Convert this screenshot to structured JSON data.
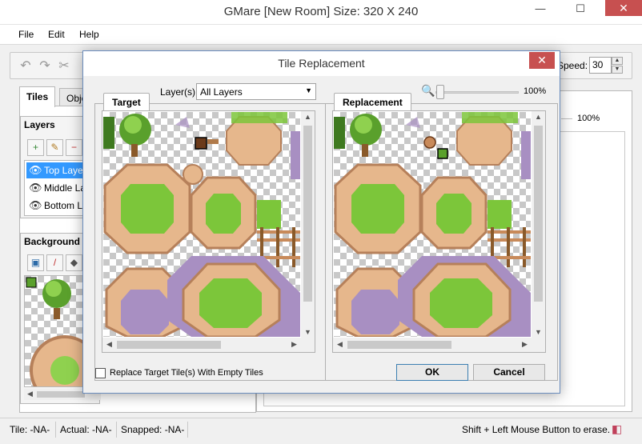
{
  "window": {
    "title": "GMare [New Room] Size: 320 X 240",
    "minimize": "—",
    "maximize": "☐",
    "close": "✕"
  },
  "menu": {
    "items": [
      "File",
      "Edit",
      "Help"
    ]
  },
  "toolbar": {
    "speed_label": "Speed:",
    "speed_value": "30"
  },
  "left_tabs": [
    "Tiles",
    "Obje"
  ],
  "layers": {
    "title": "Layers",
    "items": [
      "Top Layer",
      "Middle Layer",
      "Bottom Layer"
    ],
    "selected": 0
  },
  "background": {
    "title": "Background"
  },
  "right_panel": {
    "zoom_value": "100%"
  },
  "status": {
    "tile": "Tile: -NA-",
    "actual": "Actual: -NA-",
    "snapped": "Snapped: -NA-",
    "hint": "Shift + Left Mouse Button to erase."
  },
  "dialog": {
    "title": "Tile Replacement",
    "close": "✕",
    "target_tab": "Target",
    "replacement_tab": "Replacement",
    "layers_label": "Layer(s):",
    "layers_value": "All Layers",
    "zoom_value": "100%",
    "checkbox_label": "Replace Target Tile(s) With Empty Tiles",
    "ok_label": "OK",
    "cancel_label": "Cancel"
  },
  "colors": {
    "selection": "#3399ff",
    "close_red": "#c75050",
    "grass": "#7cc63a",
    "sand": "#e6b78c",
    "stone": "#a88fc2"
  }
}
